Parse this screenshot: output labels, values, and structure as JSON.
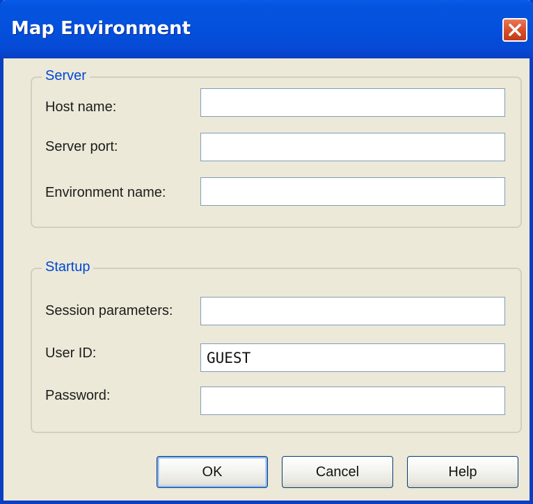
{
  "window": {
    "title": "Map Environment",
    "close_icon": "close-icon"
  },
  "server": {
    "legend": "Server",
    "host_name_label": "Host name:",
    "host_name_value": "",
    "server_port_label": "Server port:",
    "server_port_value": "",
    "environment_name_label": "Environment name:",
    "environment_name_value": ""
  },
  "startup": {
    "legend": "Startup",
    "session_parameters_label": "Session parameters:",
    "session_parameters_value": "",
    "user_id_label": "User ID:",
    "user_id_value": "GUEST",
    "password_label": "Password:",
    "password_value": ""
  },
  "buttons": {
    "ok": "OK",
    "cancel": "Cancel",
    "help": "Help"
  },
  "colors": {
    "title_bar": "#0454e0",
    "dialog_background": "#ece9d8",
    "group_legend": "#0046d5",
    "close_button": "#d9502c"
  }
}
